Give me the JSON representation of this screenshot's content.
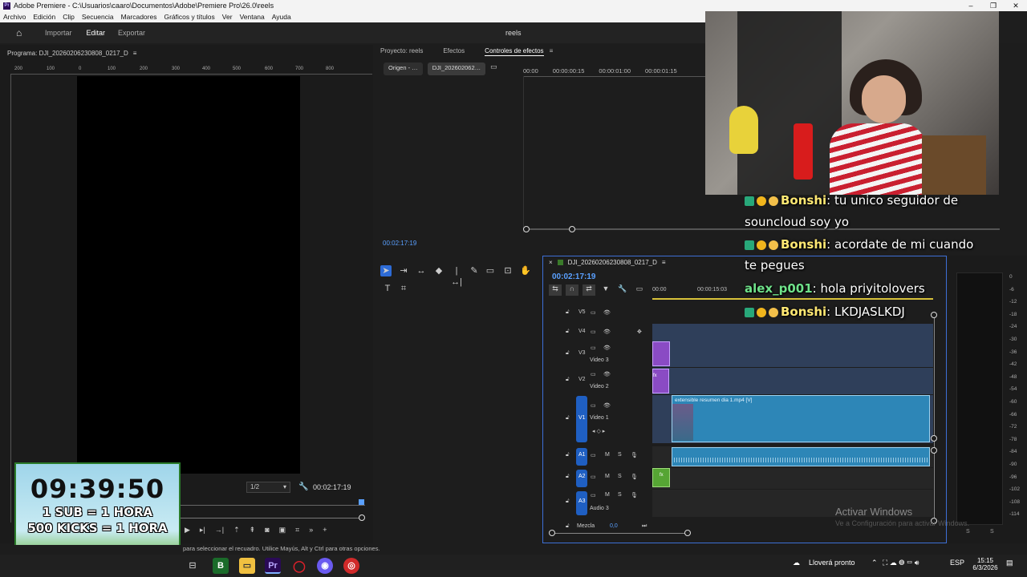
{
  "window": {
    "title": "Adobe Premiere - C:\\Usuarios\\caaro\\Documentos\\Adobe\\Premiere Pro\\26.0\\reels",
    "app_badge": "Pr",
    "minimize": "–",
    "maximize": "❐",
    "close": "✕"
  },
  "menu": [
    "Archivo",
    "Edición",
    "Clip",
    "Secuencia",
    "Marcadores",
    "Gráficos y títulos",
    "Ver",
    "Ventana",
    "Ayuda"
  ],
  "header": {
    "home": "⌂",
    "tabs": [
      {
        "label": "Importar",
        "active": false
      },
      {
        "label": "Editar",
        "active": true
      },
      {
        "label": "Exportar",
        "active": false
      }
    ],
    "project_name": "reels"
  },
  "program": {
    "title": "Programa: DJI_20260206230808_0217_D",
    "menu_icon": "≡",
    "ruler": [
      "200",
      "100",
      "0",
      "100",
      "200",
      "300",
      "400",
      "500",
      "600",
      "700",
      "800"
    ],
    "zoom": "1/2",
    "timecode": "00:02:17:19"
  },
  "overlay": {
    "countdown": "09:39:50",
    "line1": "1 SUB = 1 HORA",
    "line2": "500 KICKS = 1 HORA"
  },
  "source_panel": {
    "tabs": [
      {
        "label": "Proyecto: reels",
        "active": false
      },
      {
        "label": "Efectos",
        "active": false
      },
      {
        "label": "Controles de efectos",
        "active": true
      }
    ],
    "pill1": "Origen - …",
    "pill2": "DJI_202602062…",
    "times": [
      "00:00",
      "00:00:00:15",
      "00:00:01:00",
      "00:00:01:15"
    ],
    "timecode": "00:02:17:19"
  },
  "timeline": {
    "title": "DJI_20260206230808_0217_D",
    "timecode": "00:02:17:19",
    "ruler": [
      "00:00",
      "00:00:15:03"
    ],
    "tracks": [
      {
        "id": "V5",
        "name": ""
      },
      {
        "id": "V4",
        "name": ""
      },
      {
        "id": "V3",
        "name": "Video 3"
      },
      {
        "id": "V2",
        "name": "Video 2"
      },
      {
        "id": "V1",
        "name": "Video 1"
      },
      {
        "id": "A1",
        "name": ""
      },
      {
        "id": "A2",
        "name": ""
      },
      {
        "id": "A3",
        "name": "Audio 3"
      }
    ],
    "clip_label": "extensible resumen dia 1.mp4 [V]",
    "mix_label": "Mezcla",
    "mix_value": "0,0",
    "m": "M",
    "s": "S",
    "fx": "fx"
  },
  "meter": {
    "ticks": [
      "0",
      "-6",
      "-12",
      "-18",
      "-24",
      "-30",
      "-36",
      "-42",
      "-48",
      "-54",
      "-60",
      "-66",
      "-72",
      "-78",
      "-84",
      "-90",
      "-96",
      "-102",
      "-108",
      "-114"
    ],
    "s": "S"
  },
  "chat": [
    {
      "user": "Bonshi",
      "text": "tu unico seguidor de"
    },
    {
      "user": "",
      "text": "souncloud soy yo"
    },
    {
      "user": "Bonshi",
      "text": "acordate de mi cuando"
    },
    {
      "user": "",
      "text": "te pegues"
    },
    {
      "user": "alex_p001",
      "text": "hola priyitolovers"
    },
    {
      "user": "Bonshi",
      "text": "LKDJASLKDJ"
    }
  ],
  "watermark": {
    "title": "Activar Windows",
    "subtitle": "Ve a Configuración para activar Windows."
  },
  "status_text": "para seleccionar el recuadro. Utilice Mayús, Alt y Ctrl para otras opciones.",
  "taskbar": {
    "weather": "Lloverá pronto",
    "lang": "ESP",
    "time": "15:15",
    "date": "6/3/2026"
  },
  "colors": {
    "accent_blue": "#5aa0ff",
    "clip_blue": "#2d86b7",
    "clip_purple": "#8a4bc4",
    "clip_green": "#56a534",
    "track_select": "#1f5fc2"
  }
}
